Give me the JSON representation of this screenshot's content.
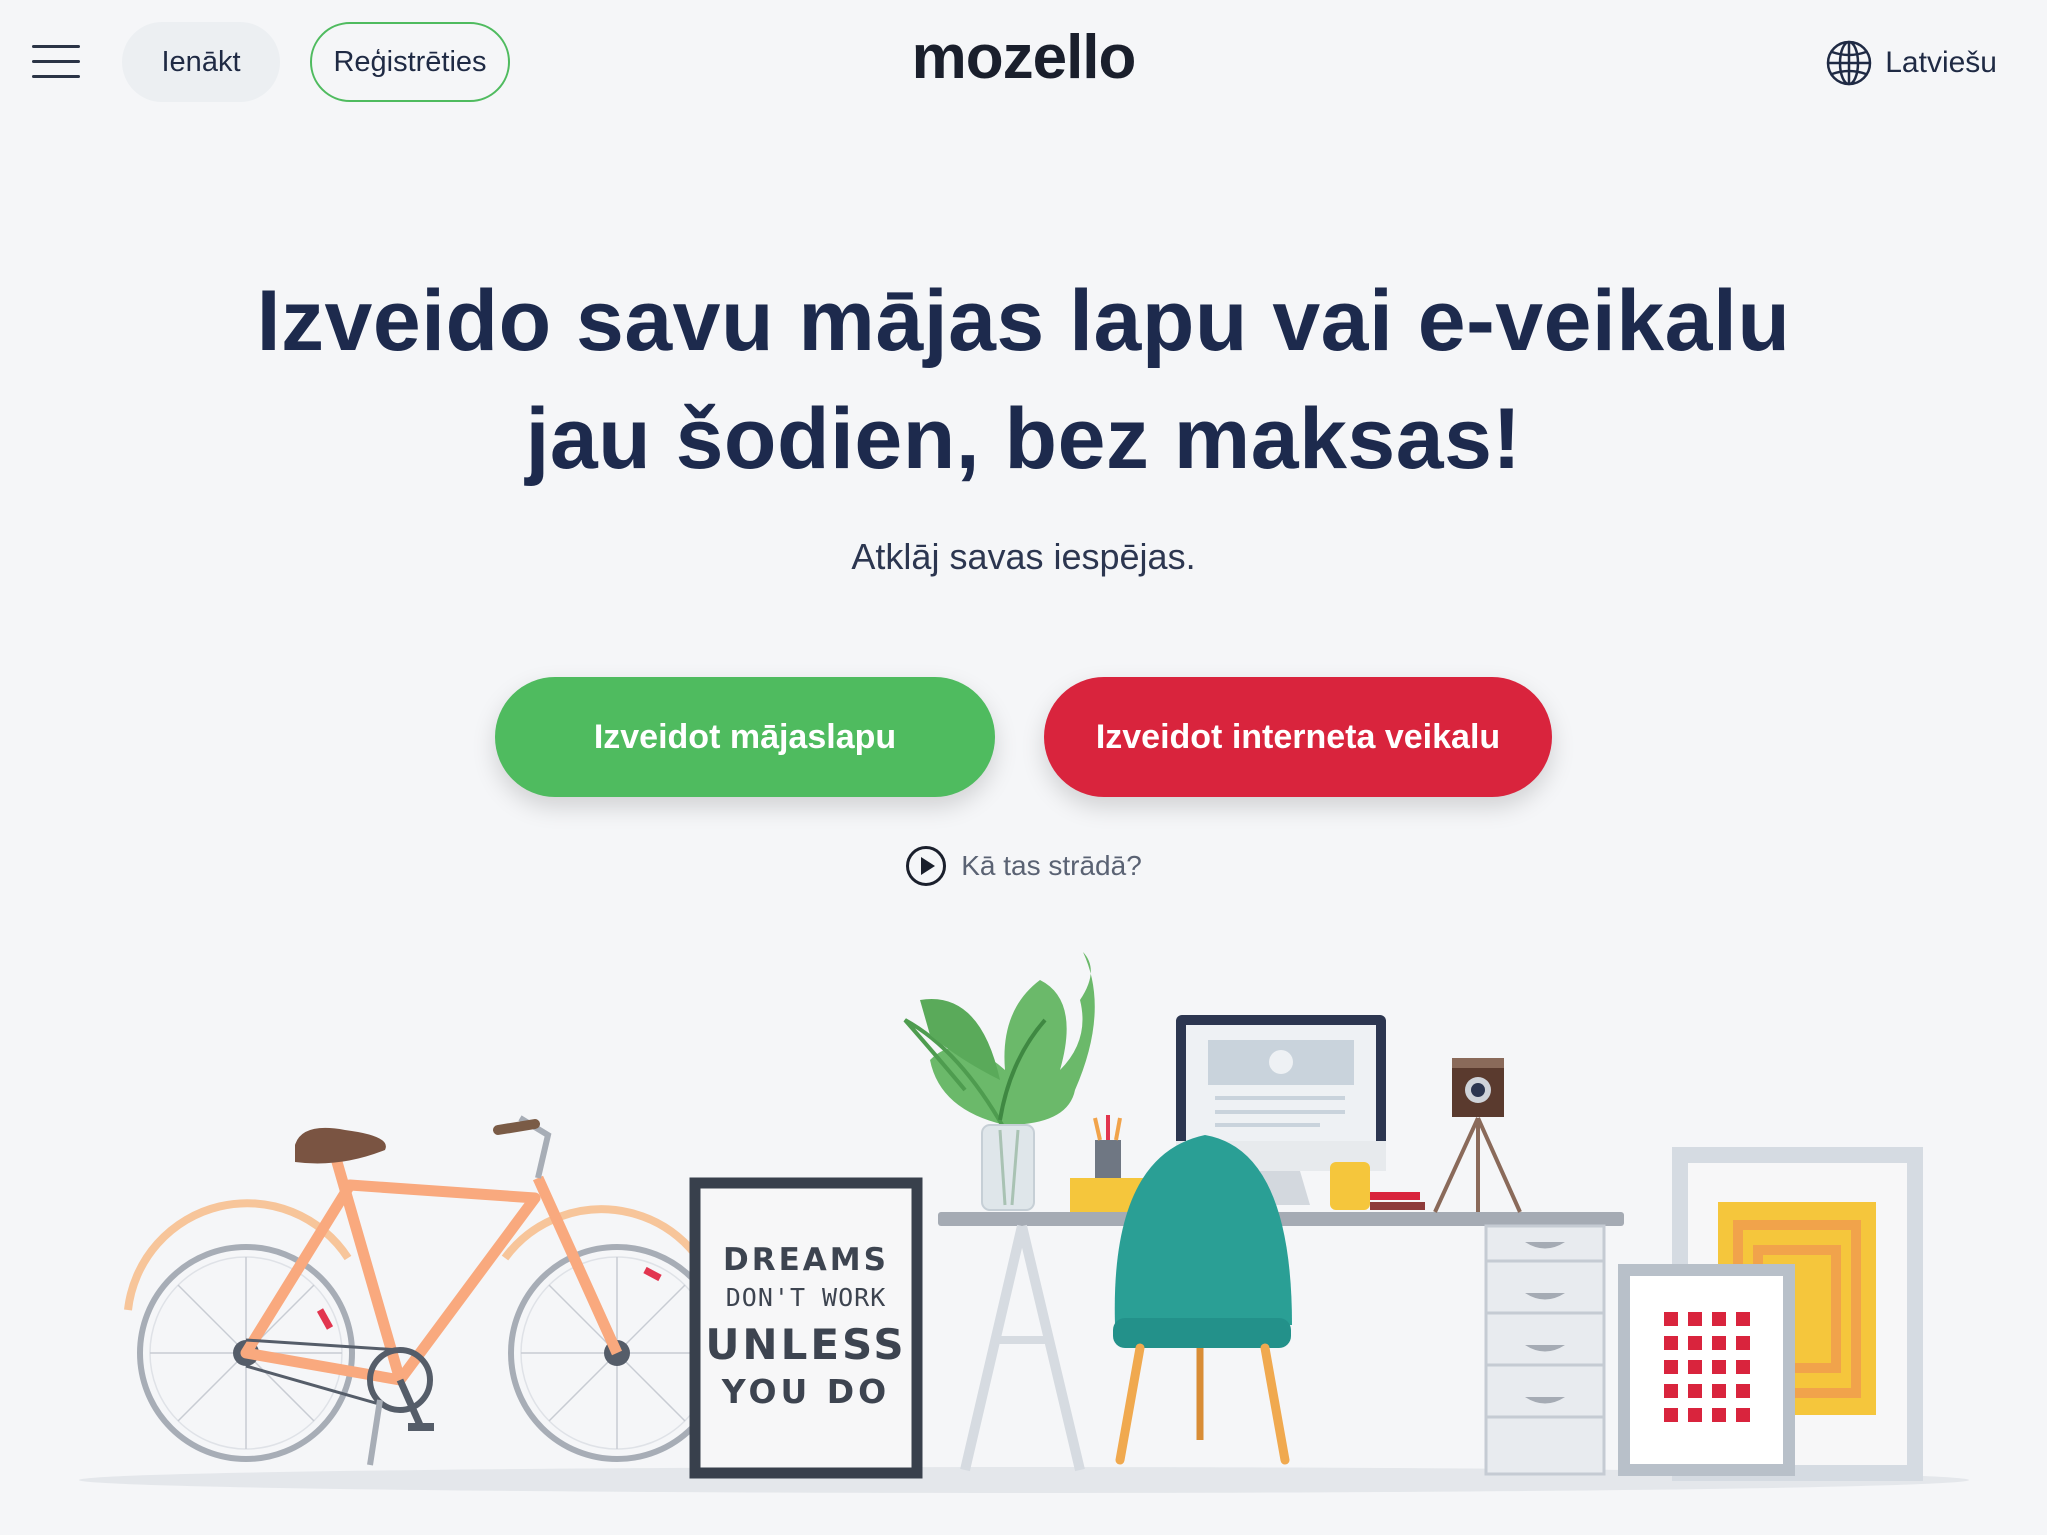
{
  "header": {
    "menu_icon": "hamburger-menu-icon",
    "login_label": "Ienākt",
    "register_label": "Reģistrēties",
    "logo_text": "mozello",
    "language_icon": "globe-icon",
    "language_label": "Latviešu"
  },
  "hero": {
    "title_line1": "Izveido savu mājas lapu vai e-veikalu",
    "title_line2": "jau šodien, bez maksas!",
    "subtitle": "Atklāj savas iespējas.",
    "cta_website_label": "Izveidot mājaslapu",
    "cta_shop_label": "Izveidot interneta veikalu",
    "howto_icon": "play-icon",
    "howto_label": "Kā tas strādā?"
  },
  "illustration": {
    "poster_line1": "DREAMS",
    "poster_line2": "DON'T WORK",
    "poster_line3": "UNLESS",
    "poster_line4": "YOU DO"
  },
  "colors": {
    "background": "#f5f6f8",
    "primary_text": "#1d2a4d",
    "green": "#4fbb5f",
    "red": "#d9243d",
    "teal_chair": "#2a9f95"
  }
}
